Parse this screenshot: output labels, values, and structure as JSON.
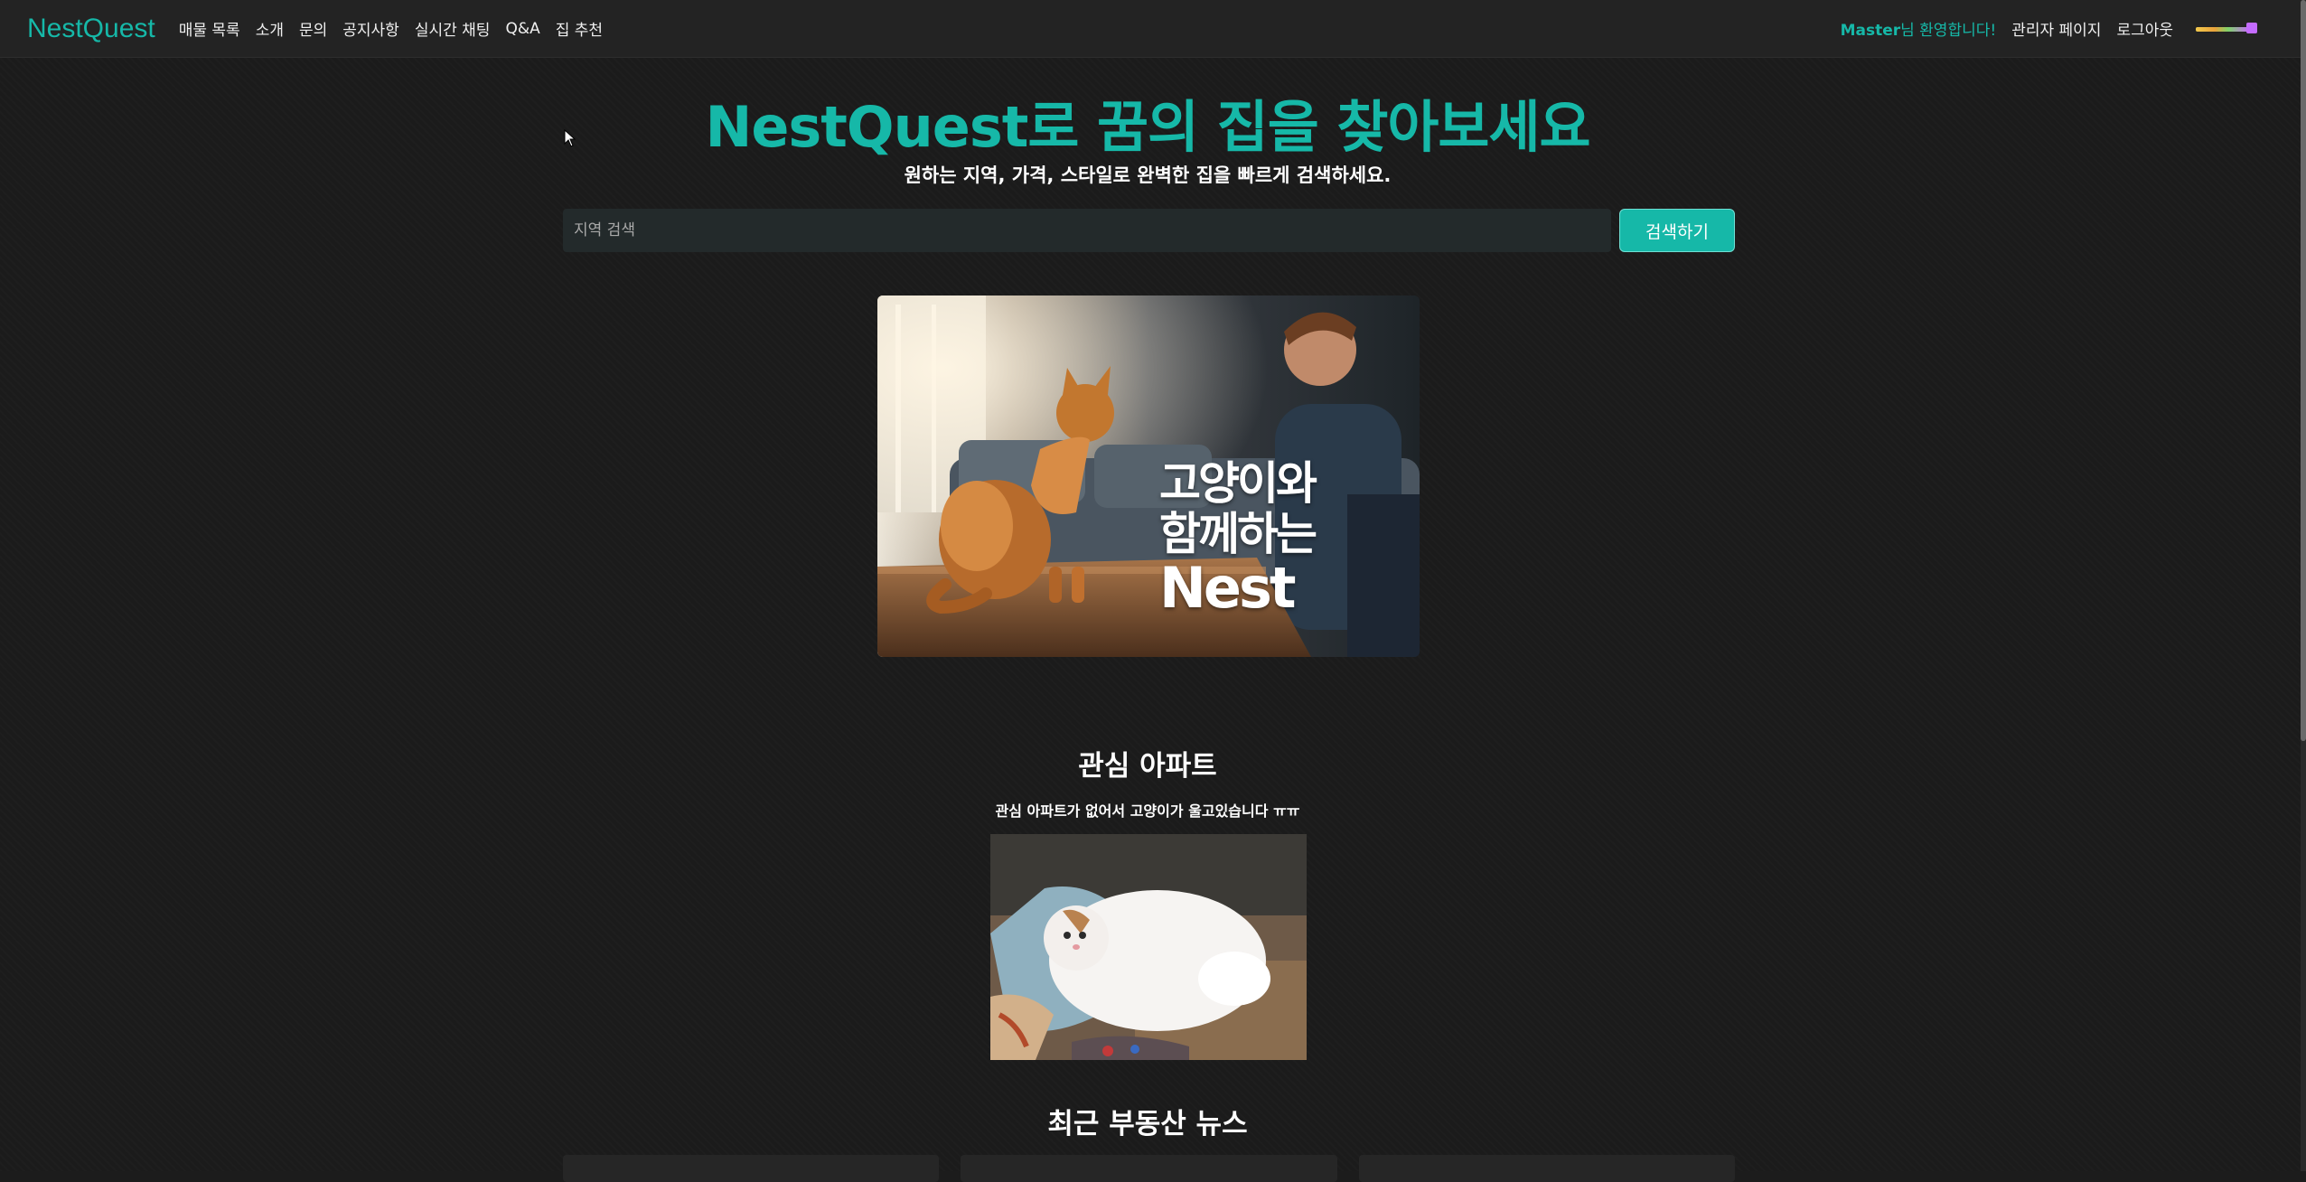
{
  "navbar": {
    "brand": "NestQuest",
    "links": [
      "매물 목록",
      "소개",
      "문의",
      "공지사항",
      "실시간 채팅",
      "Q&A",
      "집 추천"
    ],
    "welcome_name": "Master",
    "welcome_suffix": "님 환영합니다!",
    "admin_link": "관리자 페이지",
    "logout_link": "로그아웃"
  },
  "hero": {
    "title": "NestQuest로 꿈의 집을 찾아보세요",
    "subtitle": "원하는 지역, 가격, 스타일로 완벽한 집을 빠르게 검색하세요.",
    "search_placeholder": "지역 검색",
    "search_button": "검색하기"
  },
  "banner": {
    "line1": "고양이와",
    "line2": "함께하는",
    "line3": "Nest"
  },
  "favorites": {
    "title": "관심 아파트",
    "empty_message": "관심 아파트가 없어서 고양이가 울고있습니다 ㅠㅠ"
  },
  "news": {
    "title": "최근 부동산 뉴스"
  },
  "colors": {
    "accent": "#16b8a8",
    "background": "#1b1b1b",
    "navbar": "#232323"
  }
}
